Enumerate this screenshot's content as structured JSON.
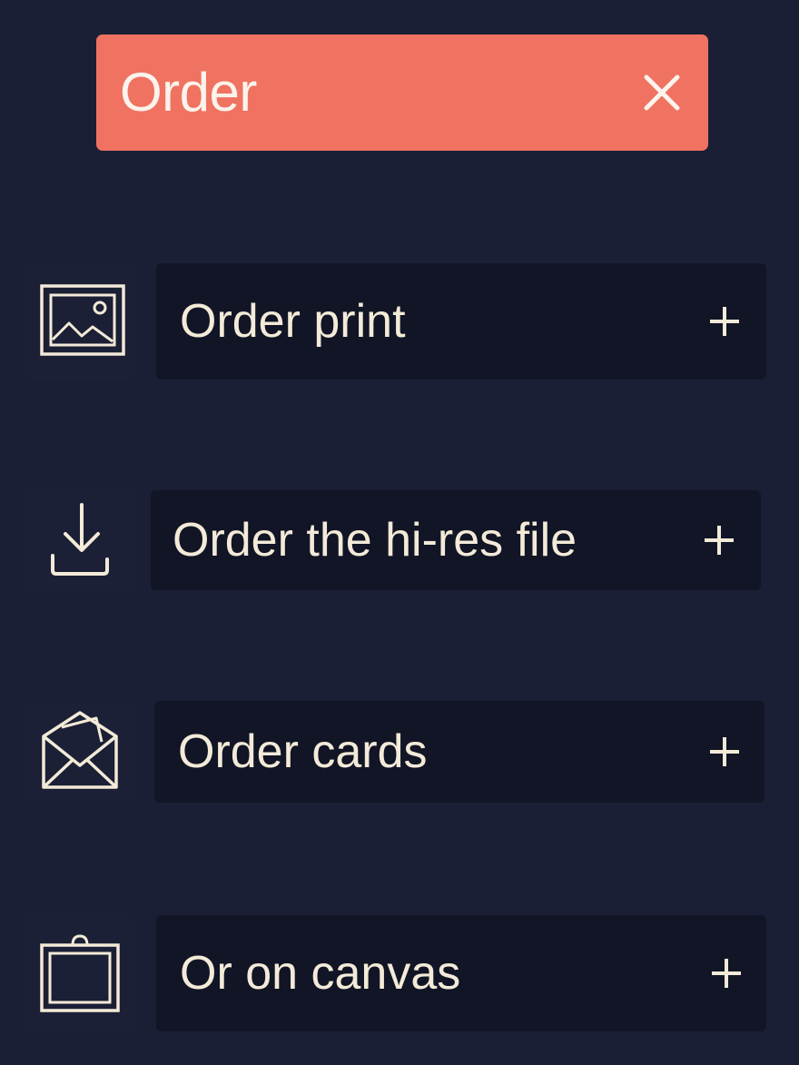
{
  "header": {
    "title": "Order",
    "close_icon": "close-icon",
    "color": "#f07261"
  },
  "options": [
    {
      "label": "Order print",
      "icon": "framed-picture-icon",
      "action_icon": "plus-icon"
    },
    {
      "label": "Order the hi-res file",
      "icon": "download-icon",
      "action_icon": "plus-icon"
    },
    {
      "label": "Order cards",
      "icon": "envelope-icon",
      "action_icon": "plus-icon"
    },
    {
      "label": "Or on canvas",
      "icon": "canvas-frame-icon",
      "action_icon": "plus-icon"
    }
  ],
  "colors": {
    "background": "#1b1f35",
    "option_background": "#111526",
    "text": "#f3ead8"
  }
}
